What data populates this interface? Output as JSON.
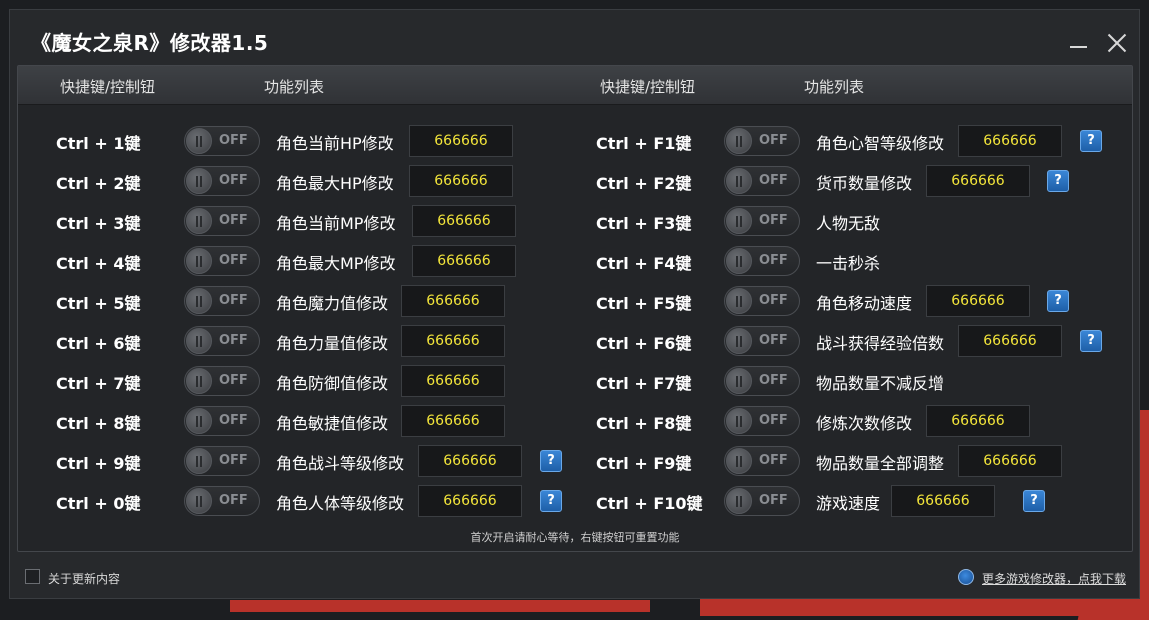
{
  "window": {
    "title": "《魔女之泉R》修改器1.5"
  },
  "header": {
    "hotkey_col": "快捷键/控制钮",
    "function_col": "功能列表"
  },
  "toggle_text": "OFF",
  "help_text": "?",
  "left_rows": [
    {
      "key": "Ctrl + 1键",
      "label": "角色当前HP修改",
      "value": "666666",
      "help": false
    },
    {
      "key": "Ctrl + 2键",
      "label": "角色最大HP修改",
      "value": "666666",
      "help": false
    },
    {
      "key": "Ctrl + 3键",
      "label": "角色当前MP修改",
      "value": "666666",
      "help": false
    },
    {
      "key": "Ctrl + 4键",
      "label": "角色最大MP修改",
      "value": "666666",
      "help": false
    },
    {
      "key": "Ctrl + 5键",
      "label": "角色魔力值修改",
      "value": "666666",
      "help": false
    },
    {
      "key": "Ctrl + 6键",
      "label": "角色力量值修改",
      "value": "666666",
      "help": false
    },
    {
      "key": "Ctrl + 7键",
      "label": "角色防御值修改",
      "value": "666666",
      "help": false
    },
    {
      "key": "Ctrl + 8键",
      "label": "角色敏捷值修改",
      "value": "666666",
      "help": false
    },
    {
      "key": "Ctrl + 9键",
      "label": "角色战斗等级修改",
      "value": "666666",
      "help": true
    },
    {
      "key": "Ctrl + 0键",
      "label": "角色人体等级修改",
      "value": "666666",
      "help": true
    }
  ],
  "right_rows": [
    {
      "key": "Ctrl + F1键",
      "label": "角色心智等级修改",
      "value": "666666",
      "help": true
    },
    {
      "key": "Ctrl + F2键",
      "label": "货币数量修改",
      "value": "666666",
      "help": true
    },
    {
      "key": "Ctrl + F3键",
      "label": "人物无敌",
      "value": null,
      "help": false
    },
    {
      "key": "Ctrl + F4键",
      "label": "一击秒杀",
      "value": null,
      "help": false
    },
    {
      "key": "Ctrl + F5键",
      "label": "角色移动速度",
      "value": "666666",
      "help": true
    },
    {
      "key": "Ctrl + F6键",
      "label": "战斗获得经验倍数",
      "value": "666666",
      "help": true
    },
    {
      "key": "Ctrl + F7键",
      "label": "物品数量不减反增",
      "value": null,
      "help": false
    },
    {
      "key": "Ctrl + F8键",
      "label": "修炼次数修改",
      "value": "666666",
      "help": false
    },
    {
      "key": "Ctrl + F9键",
      "label": "物品数量全部调整",
      "value": "666666",
      "help": false
    },
    {
      "key": "Ctrl + F10键",
      "label": "游戏速度",
      "value": "666666",
      "help": true
    }
  ],
  "hint": "首次开启请耐心等待，右键按钮可重置功能",
  "footer": {
    "update_label": "关于更新内容",
    "more_link": "更多游戏修改器，点我下载"
  }
}
